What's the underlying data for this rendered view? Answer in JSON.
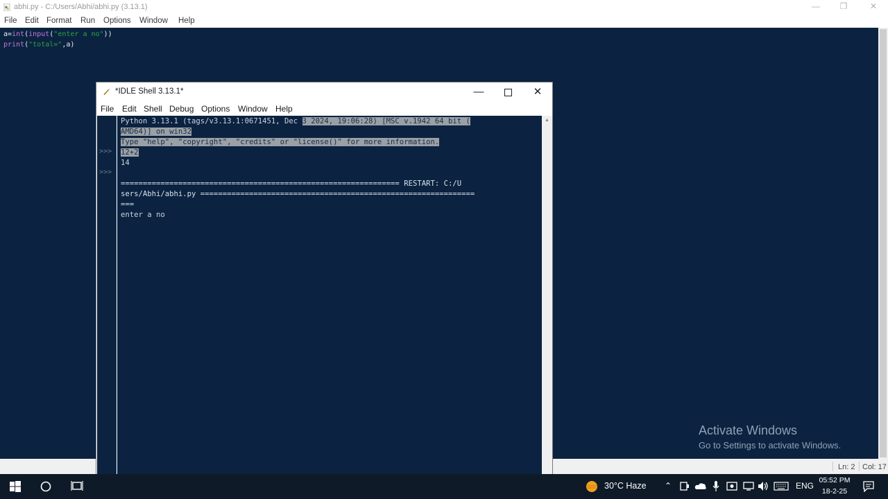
{
  "editor": {
    "title": "abhi.py - C:/Users/Abhi/abhi.py (3.13.1)",
    "menu": [
      "File",
      "Edit",
      "Format",
      "Run",
      "Options",
      "Window",
      "Help"
    ],
    "code_lines": [
      {
        "var": "a",
        "eq": "=",
        "fn1": "int",
        "p1": "(",
        "fn2": "input",
        "p2": "(",
        "str": "\"enter a no\"",
        "p3": "))"
      },
      {
        "fn": "print",
        "p1": "(",
        "str": "\"total=\"",
        "rest": ",a)"
      }
    ],
    "status": {
      "line": "Ln: 2",
      "col": "Col: 17"
    }
  },
  "watermark": {
    "title": "Activate Windows",
    "subtitle": "Go to Settings to activate Windows."
  },
  "shell": {
    "title": "*IDLE Shell 3.13.1*",
    "menu": [
      "File",
      "Edit",
      "Shell",
      "Debug",
      "Options",
      "Window",
      "Help"
    ],
    "lines": {
      "l1a": "Python 3.13.1 (tags/v3.13.1:0671451, Dec ",
      "l1b": "3 2024, 19:06:28) [MSC v.1942 64 bit (",
      "l2": "AMD64)] on win32",
      "l3": "Type \"help\", \"copyright\", \"credits\" or \"license()\" for more information.",
      "l4": "12+2",
      "l5": "14",
      "l6": "=============================================================== RESTART: C:/U",
      "l7": "sers/Abhi/abhi.py ==============================================================",
      "l8": "===",
      "l9": "enter a no"
    },
    "prompts": [
      ">>>",
      ">>>"
    ]
  },
  "taskbar": {
    "weather": "30°C  Haze",
    "language": "ENG",
    "time": "05:52 PM",
    "date": "18-2-25",
    "icons": [
      "windows-start-icon",
      "search-circle-icon",
      "task-view-icon",
      "weather-sun-icon",
      "chevron-up-icon",
      "meet-now-icon",
      "onedrive-cloud-icon",
      "microphone-icon",
      "camera-icon",
      "network-icon",
      "volume-icon",
      "keyboard-icon",
      "notifications-icon"
    ]
  }
}
